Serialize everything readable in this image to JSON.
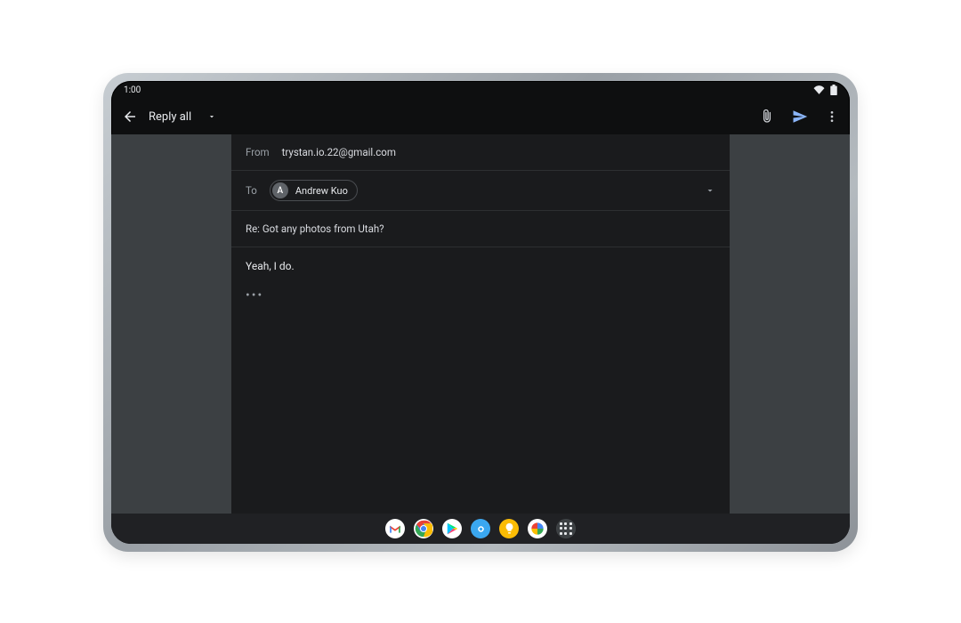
{
  "status": {
    "time": "1:00"
  },
  "toolbar": {
    "title": "Reply all"
  },
  "compose": {
    "from_label": "From",
    "from_value": "trystan.io.22@gmail.com",
    "to_label": "To",
    "to_chip": {
      "initial": "A",
      "name": "Andrew Kuo"
    },
    "subject": "Re: Got any photos from Utah?",
    "body": "Yeah, I do.",
    "quoted_toggle": "•••"
  },
  "dock": {
    "items": [
      {
        "name": "gmail"
      },
      {
        "name": "chrome"
      },
      {
        "name": "play-store"
      },
      {
        "name": "camera"
      },
      {
        "name": "keep-notes"
      },
      {
        "name": "photos"
      },
      {
        "name": "app-grid"
      }
    ]
  }
}
